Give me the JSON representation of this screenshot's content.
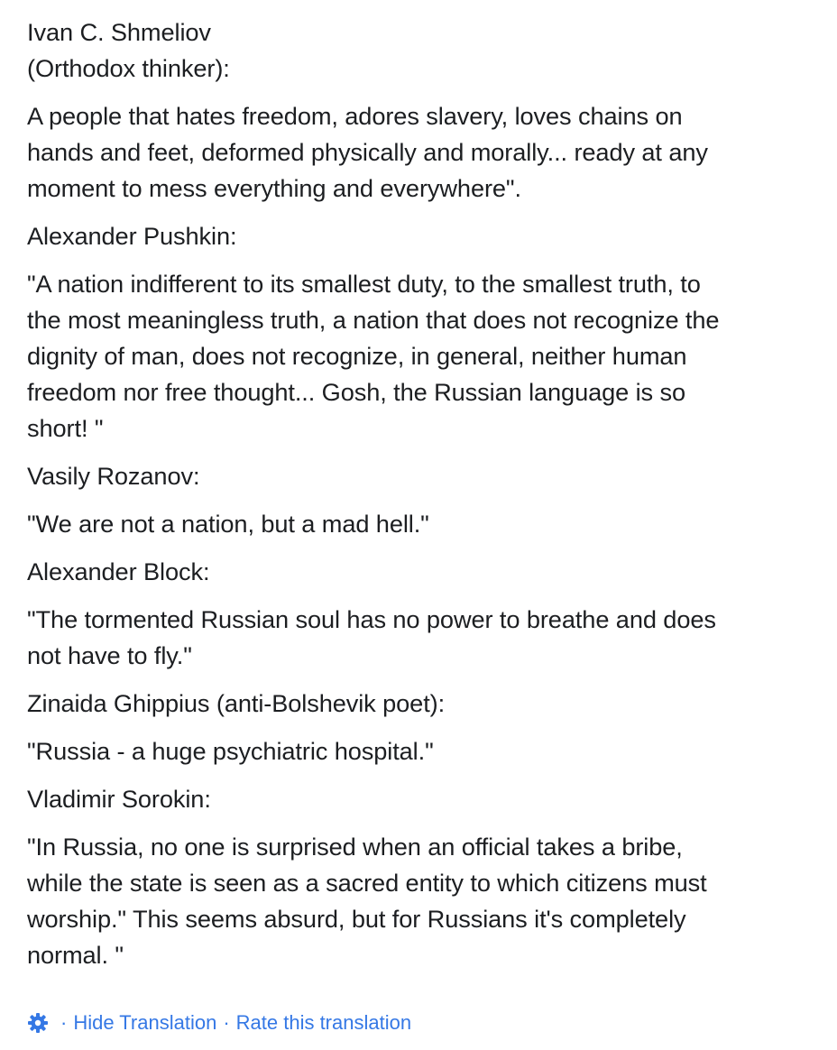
{
  "post": {
    "paragraphs": [
      {
        "lines": [
          "Ivan C. Shmeliov",
          "(Orthodox thinker):"
        ]
      },
      {
        "lines": [
          "A people that hates freedom, adores slavery, loves chains on",
          "hands and feet, deformed physically and morally... ready at any",
          "moment to mess everything and everywhere\"."
        ]
      },
      {
        "lines": [
          "Alexander Pushkin:"
        ]
      },
      {
        "lines": [
          "\"A nation indifferent to its smallest duty, to the smallest truth, to",
          "the most meaningless truth, a nation that does not recognize the",
          "dignity of man, does not recognize, in general, neither human",
          "freedom nor free thought... Gosh, the Russian language is so",
          "short! \""
        ]
      },
      {
        "lines": [
          "Vasily Rozanov:"
        ]
      },
      {
        "lines": [
          "\"We are not a nation, but a mad hell.\""
        ]
      },
      {
        "lines": [
          "Alexander Block:"
        ]
      },
      {
        "lines": [
          "\"The tormented Russian soul has no power to breathe and does",
          "not have to fly.\""
        ]
      },
      {
        "lines": [
          "Zinaida Ghippius (anti-Bolshevik poet):"
        ]
      },
      {
        "lines": [
          "\"Russia - a huge psychiatric hospital.\""
        ]
      },
      {
        "lines": [
          "Vladimir Sorokin:"
        ]
      },
      {
        "lines": [
          "\"In Russia, no one is surprised when an official takes a bribe,",
          "while the state is seen as a sacred entity to which citizens must",
          "worship.\" This seems absurd, but for Russians it's completely",
          "normal. \""
        ]
      }
    ]
  },
  "footer": {
    "icon": "gear-icon",
    "separator": "·",
    "hide_translation": "Hide Translation",
    "rate_translation": "Rate this translation"
  },
  "colors": {
    "text": "#1c1e21",
    "link": "#3578e5"
  }
}
